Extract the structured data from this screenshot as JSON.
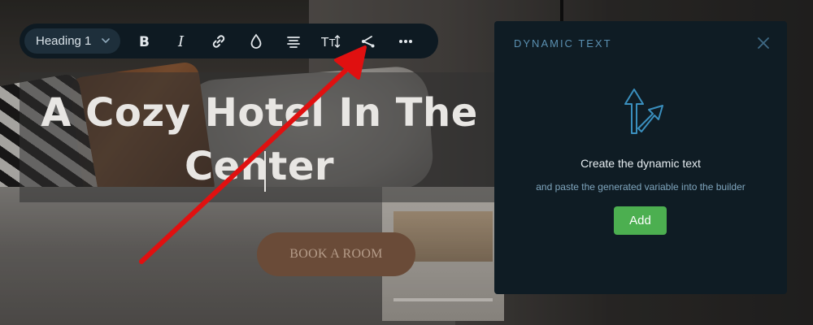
{
  "toolbar": {
    "heading_select": "Heading 1",
    "buttons": [
      {
        "icon": "bold-icon"
      },
      {
        "icon": "italic-icon"
      },
      {
        "icon": "link-icon"
      },
      {
        "icon": "color-drop-icon"
      },
      {
        "icon": "align-center-icon"
      },
      {
        "icon": "text-size-icon"
      },
      {
        "icon": "dynamic-text-icon"
      },
      {
        "icon": "more-icon"
      }
    ]
  },
  "hero": {
    "heading_line1": "A Cozy Hotel In The",
    "heading_line2": "Center",
    "book_button": "BOOK A ROOM"
  },
  "dynamic_panel": {
    "title": "DYNAMIC TEXT",
    "heading": "Create the dynamic text",
    "subtext": "and paste the generated variable into the builder",
    "add_button": "Add"
  },
  "colors": {
    "toolbar_bg": "#0e1a22",
    "panel_bg": "#0f1c24",
    "panel_title": "#5a8fb0",
    "add_button": "#4caf50",
    "annotation_arrow": "#e01010",
    "book_button": "#6a4b38"
  }
}
